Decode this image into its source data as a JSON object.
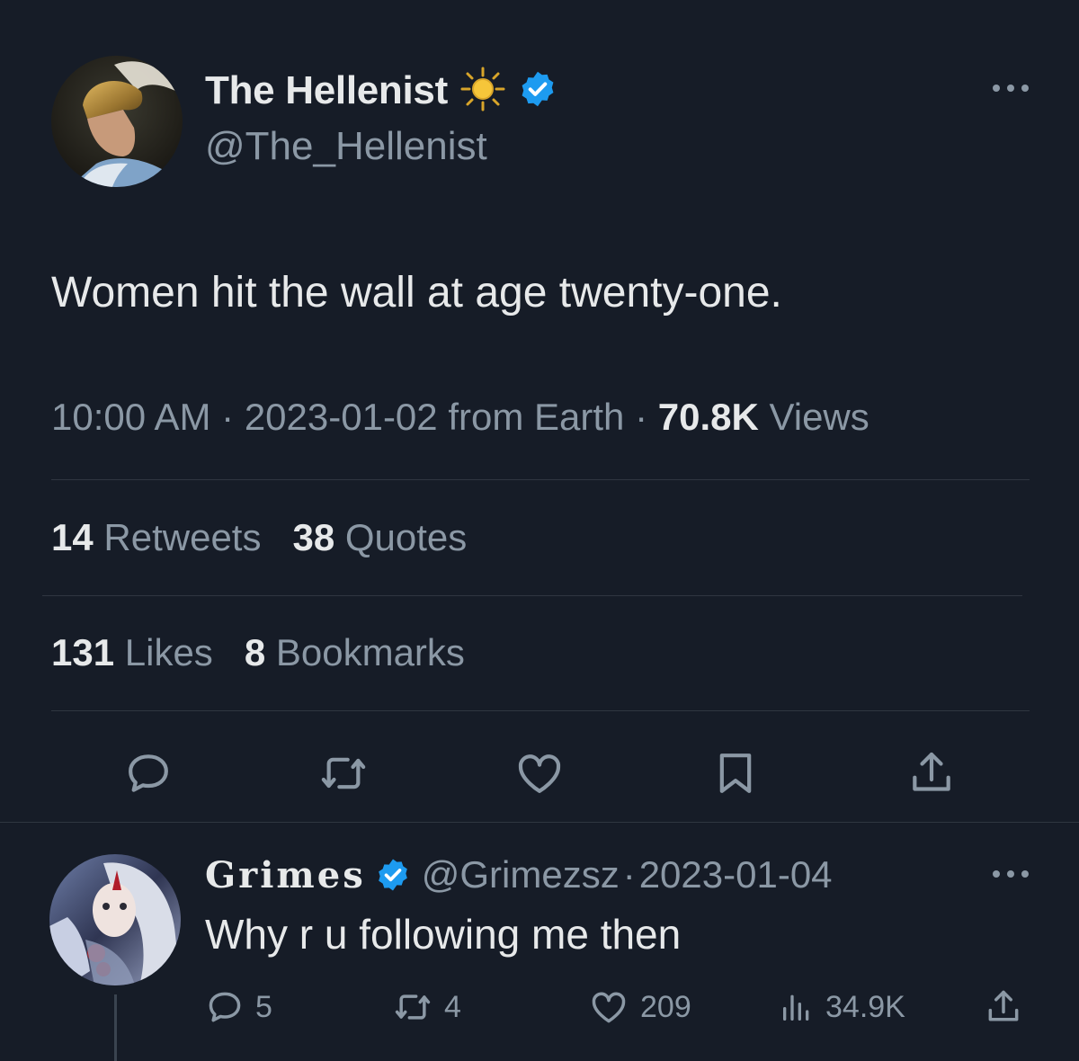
{
  "tweet": {
    "display_name": "The Hellenist",
    "name_emoji": "sun-emoji",
    "handle": "@The_Hellenist",
    "text": "Women hit the wall at age twenty-one.",
    "time": "10:00 AM",
    "date": "2023-01-02",
    "source": "from Earth",
    "views_count": "70.8K",
    "views_label": "Views",
    "retweets_count": "14",
    "retweets_label": "Retweets",
    "quotes_count": "38",
    "quotes_label": "Quotes",
    "likes_count": "131",
    "likes_label": "Likes",
    "bookmarks_count": "8",
    "bookmarks_label": "Bookmarks",
    "sep": "·"
  },
  "reply": {
    "display_name": "Grimes",
    "handle": "@Grimezsz",
    "sep": "·",
    "date": "2023-01-04",
    "text": "Why r u following me then",
    "replies": "5",
    "retweets": "4",
    "likes": "209",
    "views": "34.9K"
  },
  "icons": {
    "verified": "verified-badge-icon",
    "more": "more-icon",
    "reply": "reply-icon",
    "retweet": "retweet-icon",
    "like": "heart-icon",
    "bookmark": "bookmark-icon",
    "share": "share-icon",
    "views": "views-icon"
  },
  "colors": {
    "background": "#161c27",
    "primary_text": "#e7e9ea",
    "secondary_text": "#8b98a5",
    "verified_blue": "#1d9bf0",
    "divider": "#2f3640"
  }
}
